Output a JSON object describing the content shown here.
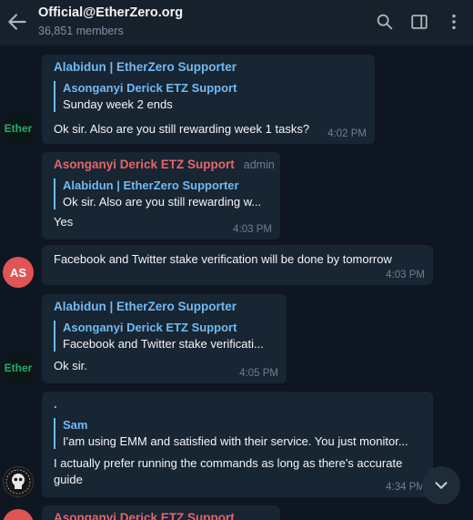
{
  "header": {
    "title": "Official@EtherZero.org",
    "members": "36,851 members"
  },
  "messages": [
    {
      "sender": "Alabidun | EtherZero Supporter",
      "reply_name": "Asonganyi Derick ETZ Support",
      "reply_text": "Sunday week 2 ends",
      "text": "Ok sir. Also are you still rewarding week 1 tasks?",
      "time": "4:02 PM",
      "avatar": "Ether"
    },
    {
      "sender": "Asonganyi Derick ETZ Support",
      "role": "admin",
      "reply_name": "Alabidun | EtherZero Supporter",
      "reply_text": "Ok sir. Also are you still rewarding w...",
      "text": "Yes",
      "time": "4:03 PM"
    },
    {
      "text": "Facebook and Twitter stake verification will be done by tomorrow",
      "time": "4:03 PM",
      "avatar": "AS"
    },
    {
      "sender": "Alabidun | EtherZero Supporter",
      "reply_name": "Asonganyi Derick ETZ Support",
      "reply_text": "Facebook and Twitter stake verificati...",
      "text": "Ok sir.",
      "time": "4:05 PM",
      "avatar": "Ether"
    },
    {
      "sender": ".",
      "reply_name": "Sam",
      "reply_text": "I'am using EMM and satisfied with their service. You just monitor...",
      "text": "I actually prefer running the commands as long as there's accurate guide",
      "time": "4:34 PM"
    },
    {
      "sender": "Asonganyi Derick ETZ Support"
    }
  ],
  "colors": {
    "background": "#0e1621",
    "header": "#17212b",
    "bubble": "#182533",
    "link_blue": "#71baf2",
    "admin_red": "#e36768",
    "meta_gray": "#6d7f8f"
  },
  "icons": {
    "back": "arrow-left-icon",
    "search": "search-icon",
    "sidebar": "sidebar-toggle-icon",
    "more": "more-vertical-icon",
    "scroll": "chevron-down-icon"
  }
}
